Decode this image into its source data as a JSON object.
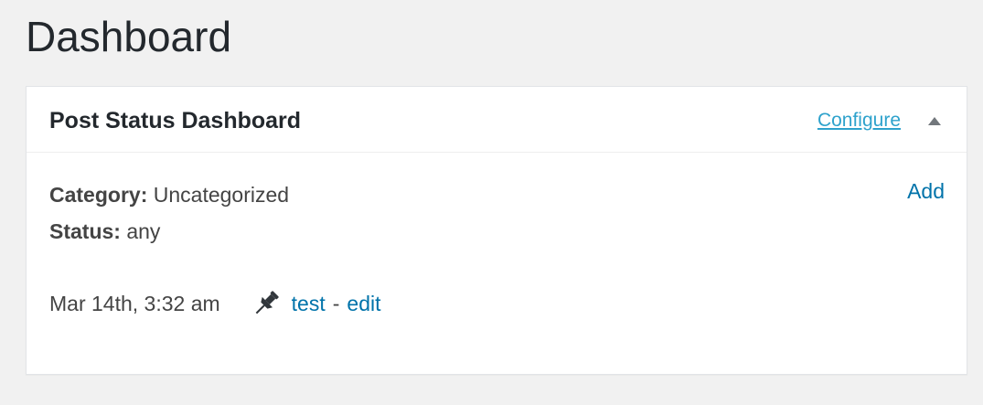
{
  "page": {
    "title": "Dashboard"
  },
  "widget": {
    "title": "Post Status Dashboard",
    "configure_label": "Configure",
    "toggle_icon": "triangle-up-icon",
    "add_label": "Add",
    "category_label": "Category:",
    "category_value": "Uncategorized",
    "status_label": "Status:",
    "status_value": "any",
    "posts": [
      {
        "date": "Mar 14th, 3:32 am",
        "pin_icon": "pushpin-icon",
        "title": "test",
        "separator": "-",
        "edit_label": "edit"
      }
    ]
  },
  "colors": {
    "background": "#f1f1f1",
    "link": "#0073aa",
    "configure_link": "#2ea2cc",
    "text": "#444444",
    "heading": "#23282d"
  }
}
